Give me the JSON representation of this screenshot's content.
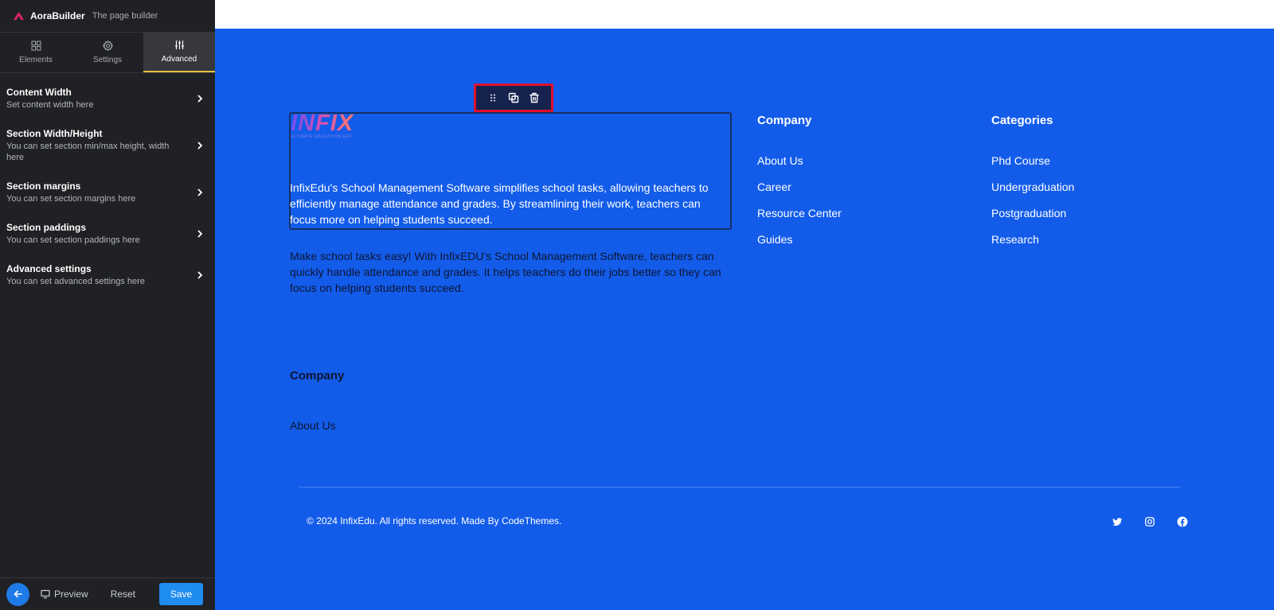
{
  "sidebar": {
    "brand": {
      "name": "AoraBuilder",
      "subtitle": "The page builder"
    },
    "tabs": [
      {
        "label": "Elements",
        "icon": "grid-icon"
      },
      {
        "label": "Settings",
        "icon": "gear-icon"
      },
      {
        "label": "Advanced",
        "icon": "sliders-icon",
        "active": true
      }
    ],
    "items": [
      {
        "title": "Content Width",
        "subtitle": "Set content width here"
      },
      {
        "title": "Section Width/Height",
        "subtitle": "You can set section min/max height, width here"
      },
      {
        "title": "Section margins",
        "subtitle": "You can set section margins here"
      },
      {
        "title": "Section paddings",
        "subtitle": "You can set section paddings here"
      },
      {
        "title": "Advanced settings",
        "subtitle": "You can set advanced settings here"
      }
    ],
    "bottom": {
      "preview_label": "Preview",
      "reset_label": "Reset",
      "save_label": "Save"
    }
  },
  "canvas": {
    "logo": {
      "word": "INFIX",
      "tagline": "ULTIMATE EDUCATION ERP"
    },
    "description_primary": "InfixEdu's School Management Software simplifies school tasks, allowing teachers to efficiently manage attendance and grades. By streamlining their work, teachers can focus more on helping students succeed.",
    "description_secondary": "Make school tasks easy! With InfixEDU's School Management Software, teachers can quickly handle attendance and grades. It helps teachers do their jobs better so they can focus on helping students succeed.",
    "company": {
      "heading": "Company",
      "links": [
        "About Us",
        "Career",
        "Resource Center",
        "Guides"
      ]
    },
    "categories": {
      "heading": "Categories",
      "links": [
        "Phd Course",
        "Undergraduation",
        "Postgraduation",
        "Research"
      ]
    },
    "company_secondary": {
      "heading": "Company",
      "links": [
        "About Us"
      ]
    },
    "copyright": "© 2024 InfixEdu. All rights reserved. Made By CodeThemes.",
    "social": [
      "twitter-icon",
      "instagram-icon",
      "facebook-icon"
    ]
  },
  "colors": {
    "sidebar_bg": "#202124",
    "footer_bg": "#135cea",
    "accent": "#1f8cf0",
    "highlight": "#e0102d",
    "active_tab_underline": "#e2c23f"
  }
}
